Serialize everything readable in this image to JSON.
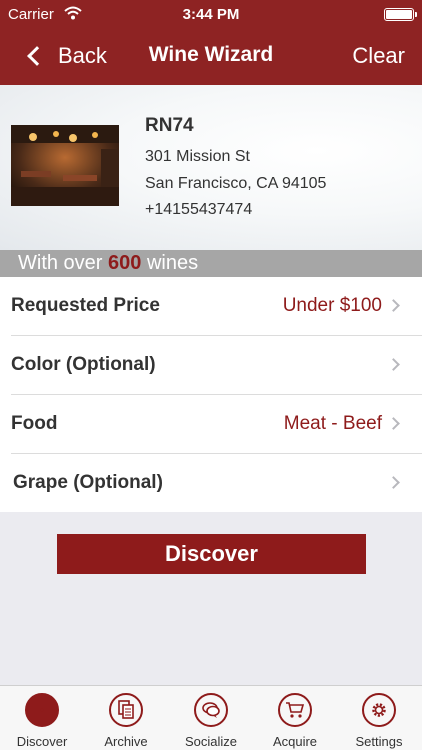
{
  "status": {
    "carrier": "Carrier",
    "time": "3:44 PM"
  },
  "nav": {
    "back_label": "Back",
    "title": "Wine Wizard",
    "clear_label": "Clear"
  },
  "restaurant": {
    "name": "RN74",
    "street": "301 Mission St",
    "city_line": "San Francisco, CA 94105",
    "phone": "+14155437474"
  },
  "banner": {
    "prefix": "With over ",
    "count": "600",
    "suffix": " wines"
  },
  "options": [
    {
      "label": "Requested Price",
      "value": "Under $100"
    },
    {
      "label": "Color (Optional)",
      "value": ""
    },
    {
      "label": "Food",
      "value": "Meat - Beef"
    },
    {
      "label": "Grape (Optional)",
      "value": ""
    }
  ],
  "discover_label": "Discover",
  "tabs": [
    {
      "label": "Discover",
      "icon": "compass-icon",
      "active": true
    },
    {
      "label": "Archive",
      "icon": "documents-icon",
      "active": false
    },
    {
      "label": "Socialize",
      "icon": "chat-bubbles-icon",
      "active": false
    },
    {
      "label": "Acquire",
      "icon": "cart-icon",
      "active": false
    },
    {
      "label": "Settings",
      "icon": "gear-icon",
      "active": false
    }
  ],
  "colors": {
    "brand": "#8e2323",
    "accent_text": "#8e1b1b",
    "banner": "#a6a6a6"
  }
}
